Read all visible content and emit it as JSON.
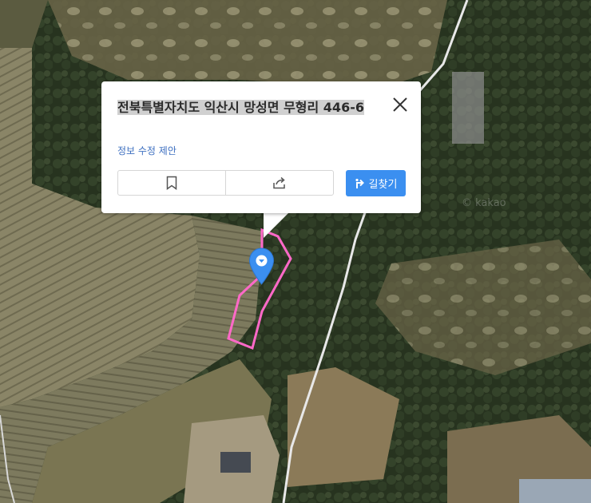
{
  "map": {
    "type": "satellite",
    "watermark": "© kakao",
    "parcel_outline_color": "#ff69c8",
    "marker_color": "#3b8ff0"
  },
  "popup": {
    "address": "전북특별자치도 익산시 망성면 무형리 446-6",
    "suggest_edit_label": "정보 수정 제안",
    "route_button_label": "길찾기",
    "icons": [
      "close-icon",
      "bookmark-icon",
      "share-icon",
      "route-arrow-icon"
    ]
  }
}
